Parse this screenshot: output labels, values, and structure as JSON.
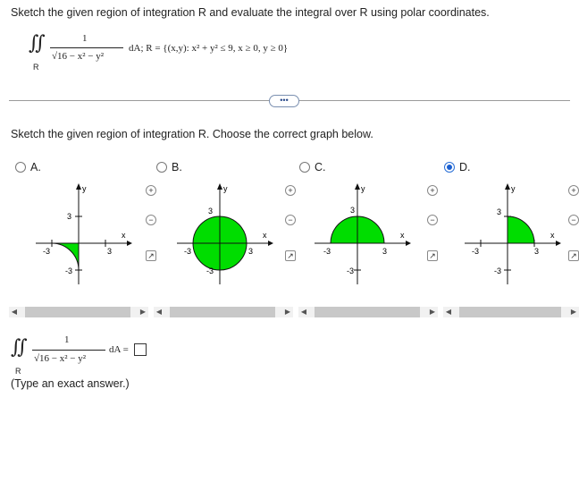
{
  "question": {
    "instruction": "Sketch the given region of integration R and evaluate the integral over R using polar coordinates.",
    "integrand_numerator": "1",
    "integrand_denominator": "√16 − x² − y²",
    "region_label": "R",
    "region_def": "dA; R = {(x,y): x² + y² ≤ 9, x ≥ 0, y ≥ 0}"
  },
  "more_button": "•••",
  "sub_question": "Sketch the given region of integration R. Choose the correct graph below.",
  "options": [
    {
      "letter": "A.",
      "selected": false,
      "shape": "quarter-circle-quadrant-IV"
    },
    {
      "letter": "B.",
      "selected": false,
      "shape": "full-circle"
    },
    {
      "letter": "C.",
      "selected": false,
      "shape": "upper-semicircle"
    },
    {
      "letter": "D.",
      "selected": true,
      "shape": "quarter-circle-quadrant-I"
    }
  ],
  "graph_labels": {
    "x": "x",
    "y": "y",
    "pos": "3",
    "neg": "-3"
  },
  "icons": {
    "zoom_in": "zoom-in-icon",
    "zoom_out": "zoom-out-icon",
    "popout": "popout-icon"
  },
  "fill_color": "#00dd00",
  "answer": {
    "numerator": "1",
    "denominator": "√16 − x² − y²",
    "region_label": "R",
    "suffix": "dA =",
    "value": "",
    "hint": "(Type an exact answer.)"
  }
}
